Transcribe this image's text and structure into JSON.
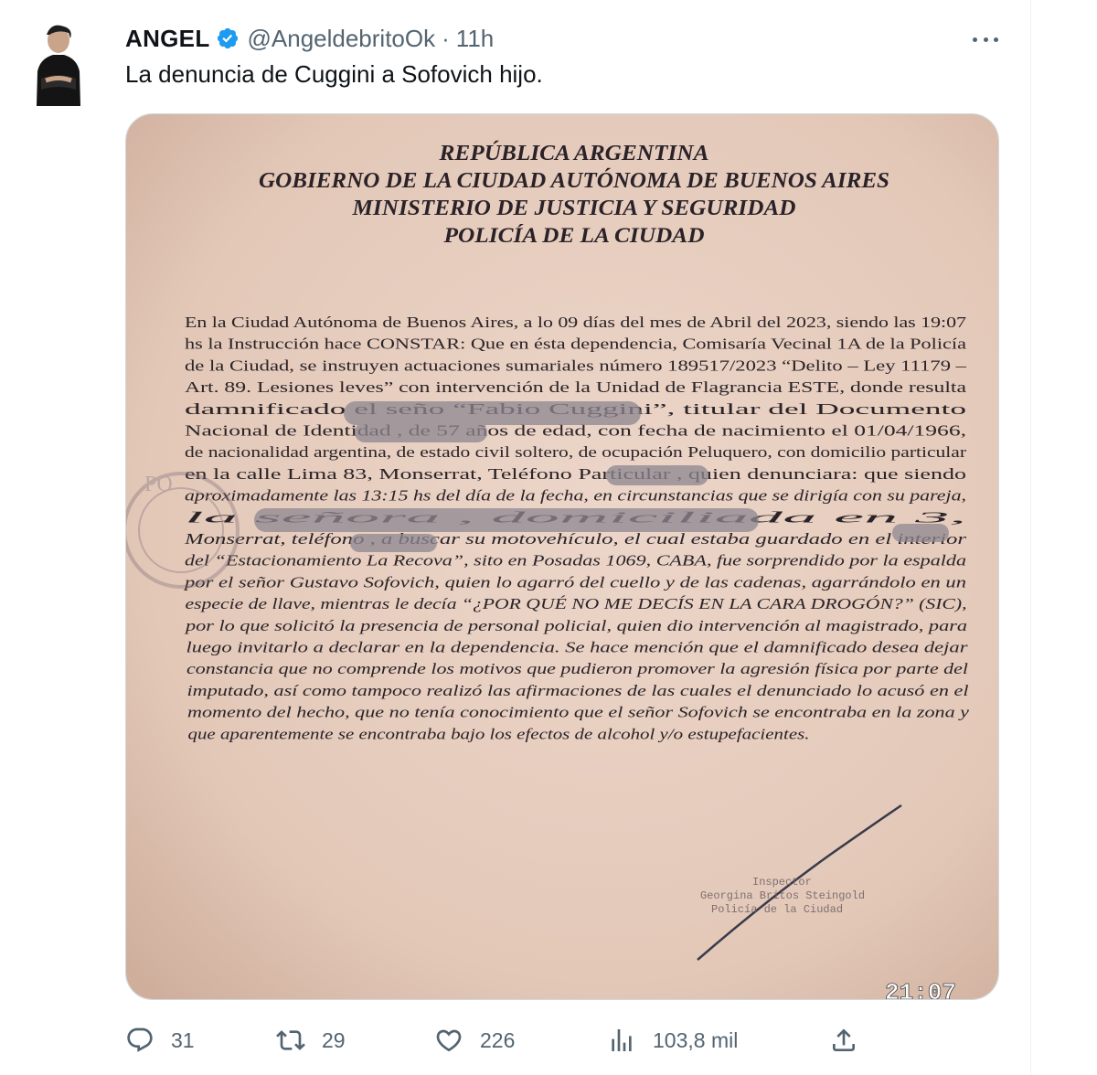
{
  "author": {
    "display_name": "ANGEL",
    "handle": "@AngeldebritoOk",
    "separator": "·",
    "time": "11h",
    "verified": true
  },
  "tweet": {
    "text": "La denuncia de Cuggini a Sofovich hijo."
  },
  "media": {
    "heading": [
      "REPÚBLICA ARGENTINA",
      "GOBIERNO DE LA CIUDAD AUTÓNOMA DE BUENOS AIRES",
      "MINISTERIO DE JUSTICIA Y SEGURIDAD",
      "POLICÍA DE LA CIUDAD"
    ],
    "body": [
      "En la Ciudad Autónoma de Buenos Aires, a lo 09 días del mes de Abril del 2023, siendo las 19:07",
      "hs la Instrucción hace CONSTAR: Que en ésta dependencia, Comisaría Vecinal 1A de la Policía",
      "de la Ciudad, se instruyen actuaciones sumariales número 189517/2023  “Delito – Ley 11179 –",
      "Art. 89. Lesiones leves” con intervención de la Unidad de Flagrancia ESTE, donde resulta",
      "damnificado el seño                              “Fabio Cuggini”,  titular del Documento",
      "Nacional de Identidad                   , de 57 años de edad, con fecha de nacimiento el 01/04/1966,",
      "de nacionalidad argentina, de estado civil soltero, de ocupación Peluquero, con domicilio particular",
      "en la calle Lima 83, Monserrat, Teléfono Particular                 , quien denunciara: que siendo",
      "aproximadamente las 13:15 hs del día de la fecha, en circunstancias que se dirigía con su pareja,",
      "la señora                                                              , domiciliada en         3,",
      "Monserrat, teléfono                , a buscar su motovehículo, el cual estaba guardado en el interior",
      "del “Estacionamiento La Recova”, sito en Posadas 1069, CABA, fue sorprendido por la espalda",
      "por el señor Gustavo Sofovich, quien lo agarró del cuello y de las cadenas, agarrándolo en un",
      "especie de llave, mientras le decía “¿POR QUÉ NO ME DECÍS EN LA CARA DROGÓN?” (SIC),",
      "por lo que solicitó la presencia de personal policial, quien dio intervención al magistrado, para",
      "luego invitarlo a declarar en la dependencia. Se hace mención que el damnificado desea dejar",
      "constancia que no comprende los motivos que pudieron promover la agresión física por parte del",
      "imputado, así como tampoco realizó las afirmaciones de las cuales el denunciado lo acusó en el",
      "momento del hecho, que no tenía conocimiento que el señor Sofovich se encontraba en la zona y",
      "que aparentemente se encontraba bajo los efectos de alcohol y/o estupefacientes."
    ],
    "stamp_text": "PO",
    "signature_block": [
      "Inspector",
      "Georgina Britos Steingold",
      "Policía de la Ciudad"
    ],
    "photo_timestamp": "21:07"
  },
  "actions": {
    "replies": "31",
    "reposts": "29",
    "likes": "226",
    "views": "103,8 mil"
  },
  "icons": {
    "verified": "verified-badge-icon",
    "more": "more-dots-icon",
    "reply": "reply-icon",
    "repost": "repost-icon",
    "like": "heart-icon",
    "views": "views-chart-icon",
    "share": "share-icon"
  },
  "colors": {
    "verified": "#1d9bf0",
    "text_primary": "#0f1419",
    "text_secondary": "#536471",
    "paper": "#e6cdbe"
  }
}
